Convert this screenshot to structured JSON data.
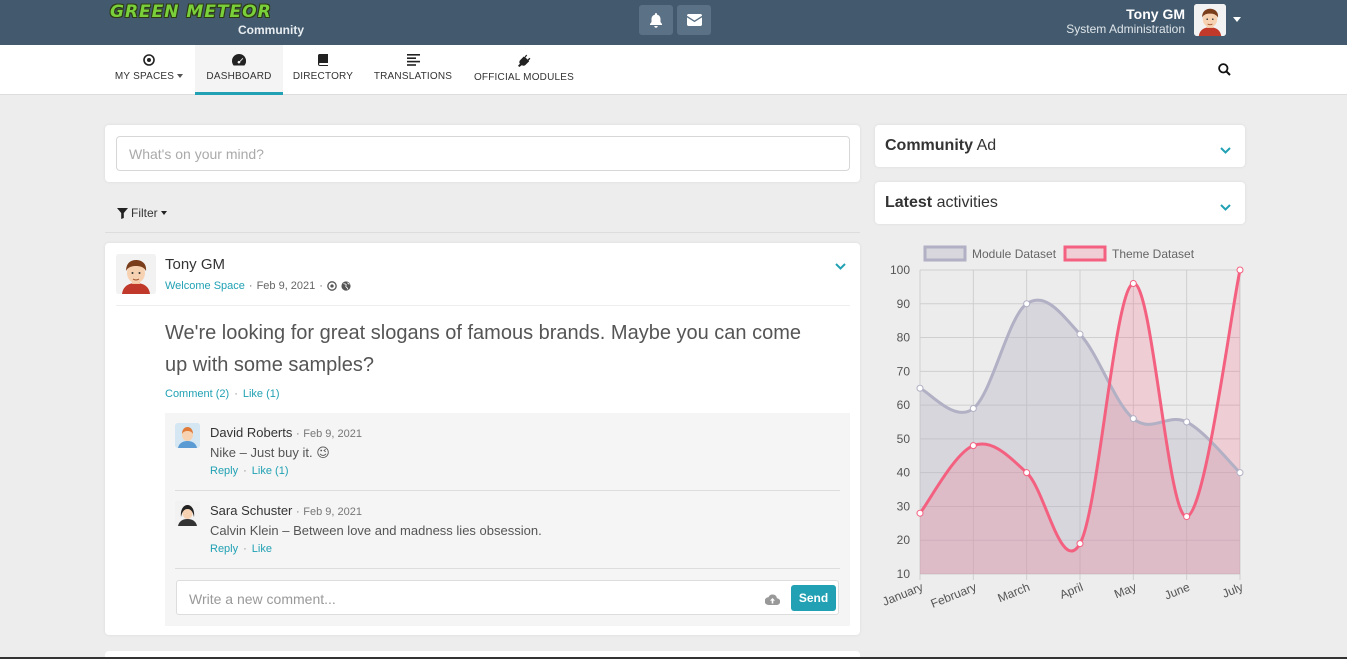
{
  "header": {
    "logo_text": "GREEN METEOR",
    "logo_sub": "Community",
    "user_name": "Tony GM",
    "user_role": "System Administration"
  },
  "nav": {
    "items": [
      {
        "label": "MY SPACES",
        "icon": "dot-circle-icon"
      },
      {
        "label": "DASHBOARD",
        "icon": "tachometer-icon"
      },
      {
        "label": "DIRECTORY",
        "icon": "book-icon"
      },
      {
        "label": "TRANSLATIONS",
        "icon": "align-left-icon"
      },
      {
        "label": "OFFICIAL MODULES",
        "icon": "plug-icon"
      }
    ],
    "active": "DASHBOARD"
  },
  "composer": {
    "placeholder": "What's on your mind?"
  },
  "filter": {
    "label": "Filter"
  },
  "post": {
    "author": "Tony GM",
    "space": "Welcome Space",
    "date": "Feb 9, 2021",
    "text": "We're looking for great slogans of famous brands. Maybe you can come up with some samples?",
    "comment_link": "Comment (2)",
    "like_link": "Like (1)"
  },
  "comments": [
    {
      "author": "David Roberts",
      "date": "Feb 9, 2021",
      "text": "Nike – Just buy it. 😉",
      "reply": "Reply",
      "like": "Like (1)"
    },
    {
      "author": "Sara Schuster",
      "date": "Feb 9, 2021",
      "text": "Calvin Klein – Between love and madness lies obsession.",
      "reply": "Reply",
      "like": "Like"
    }
  ],
  "comment_input": {
    "placeholder": "Write a new comment...",
    "send_label": "Send"
  },
  "sidebar": {
    "community_ad": {
      "bold": "Community",
      "rest": "Ad"
    },
    "latest": {
      "bold": "Latest",
      "rest": "activities"
    }
  },
  "colors": {
    "topbar": "#435a6e",
    "accent": "#21a1b3",
    "module_series": "#b1b0c4",
    "theme_series": "#f4607f"
  },
  "chart_data": {
    "type": "line",
    "x": [
      "January",
      "February",
      "March",
      "April",
      "May",
      "June",
      "July"
    ],
    "ylim": [
      10,
      100
    ],
    "yticks": [
      10,
      20,
      30,
      40,
      50,
      60,
      70,
      80,
      90,
      100
    ],
    "grid": true,
    "legend_position": "top",
    "series": [
      {
        "name": "Module Dataset",
        "values": [
          65,
          59,
          90,
          81,
          56,
          55,
          40
        ],
        "color": "#b1b0c4"
      },
      {
        "name": "Theme Dataset",
        "values": [
          28,
          48,
          40,
          19,
          96,
          27,
          100
        ],
        "color": "#f4607f"
      }
    ]
  }
}
